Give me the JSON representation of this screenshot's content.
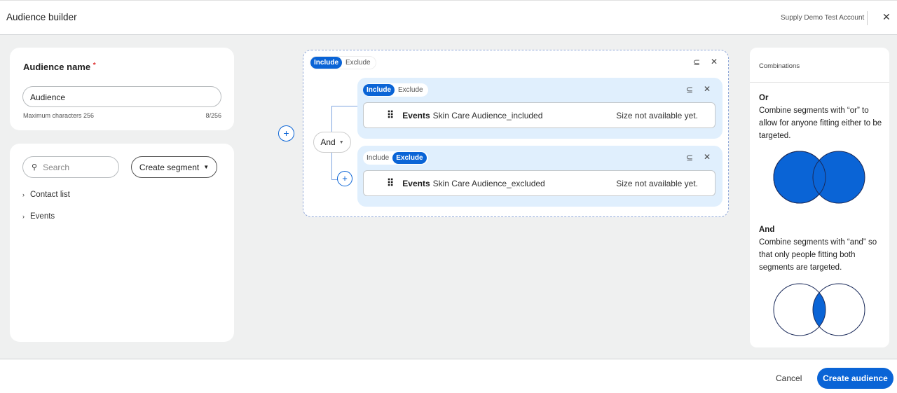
{
  "header": {
    "title": "Audience builder",
    "account": "Supply Demo Test Account",
    "close_icon": "close-icon"
  },
  "name_card": {
    "label": "Audience name",
    "required": "*",
    "value": "Audience",
    "hint": "Maximum characters 256",
    "count": "8/256"
  },
  "library": {
    "search_placeholder": "Search",
    "create_segment": "Create segment",
    "items": [
      {
        "label": "Contact list"
      },
      {
        "label": "Events"
      }
    ]
  },
  "builder": {
    "outer_toggle": {
      "include": "Include",
      "exclude": "Exclude",
      "selected": "Include"
    },
    "operator": "And",
    "segments": [
      {
        "include": "Include",
        "exclude": "Exclude",
        "selected": "Include",
        "type": "Events",
        "name": "Skin Care Audience_included",
        "size": "Size not available yet."
      },
      {
        "include": "Include",
        "exclude": "Exclude",
        "selected": "Exclude",
        "type": "Events",
        "name": "Skin Care Audience_excluded",
        "size": "Size not available yet."
      }
    ]
  },
  "combinations": {
    "title": "Combinations",
    "or_title": "Or",
    "or_text": "Combine segments with “or” to allow for anyone fitting either to be targeted.",
    "and_title": "And",
    "and_text": "Combine segments with “and” so that only people fitting both segments are targeted."
  },
  "footer": {
    "cancel": "Cancel",
    "create": "Create audience"
  },
  "colors": {
    "accent": "#0a64d6",
    "block": "#e0effd",
    "bg": "#eff0f0"
  }
}
